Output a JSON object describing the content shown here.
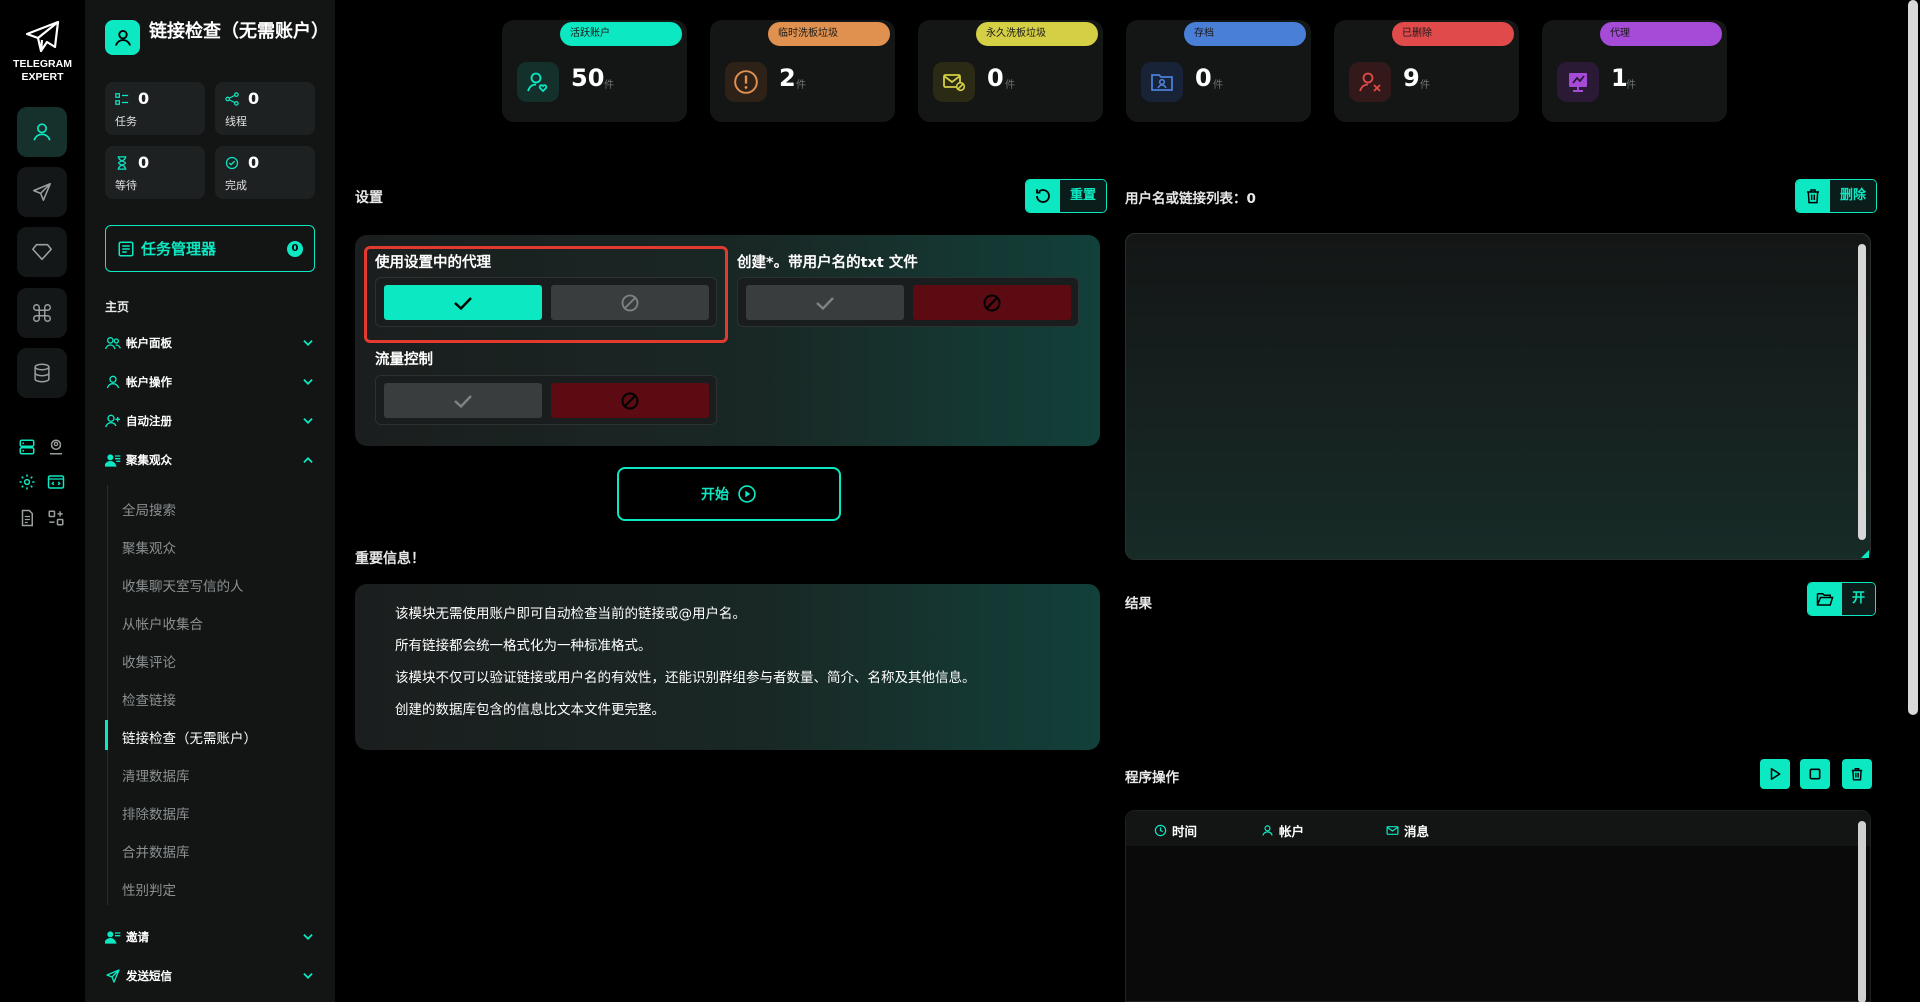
{
  "app": {
    "logo_line1": "TELEGRAM",
    "logo_line2": "EXPERT",
    "accent": "#0ce8c2"
  },
  "sidebar": {
    "page_title": "链接检查（无需账户）",
    "stats": [
      {
        "label": "任务",
        "value": "0",
        "icon": "tasks-icon"
      },
      {
        "label": "线程",
        "value": "0",
        "icon": "threads-icon"
      },
      {
        "label": "等待",
        "value": "0",
        "icon": "hourglass-icon"
      },
      {
        "label": "完成",
        "value": "0",
        "icon": "check-circle-icon"
      }
    ],
    "task_manager": {
      "label": "任务管理器",
      "count": "0"
    },
    "home": "主页",
    "groups": [
      {
        "label": "帐户面板",
        "icon": "users-icon",
        "expanded": false
      },
      {
        "label": "帐户操作",
        "icon": "user-icon",
        "expanded": false
      },
      {
        "label": "自动注册",
        "icon": "user-plus-icon",
        "expanded": false
      },
      {
        "label": "聚集观众",
        "icon": "audience-icon",
        "expanded": true
      }
    ],
    "sub_items": [
      "全局搜索",
      "聚集观众",
      "收集聊天室写信的人",
      "从帐户收集合",
      "收集评论",
      "检查链接",
      "链接检查（无需账户）",
      "清理数据库",
      "排除数据库",
      "合并数据库",
      "性别判定"
    ],
    "active_sub_index": 6,
    "groups_bottom": [
      {
        "label": "邀请",
        "icon": "invite-icon",
        "expanded": false
      },
      {
        "label": "发送短信",
        "icon": "send-icon",
        "expanded": false
      }
    ]
  },
  "top_cards": [
    {
      "tag": "活跃账户",
      "value": "50",
      "unit": "件",
      "color": "#0ce8c2",
      "icon": "user-heart-icon"
    },
    {
      "tag": "临时洗板垃圾",
      "value": "2",
      "unit": "件",
      "color": "#e0904f",
      "icon": "alert-icon"
    },
    {
      "tag": "永久洗板垃圾",
      "value": "0",
      "unit": "件",
      "color": "#d4cf44",
      "icon": "mail-block-icon"
    },
    {
      "tag": "存档",
      "value": "0",
      "unit": "件",
      "color": "#4a7fd8",
      "icon": "archive-icon"
    },
    {
      "tag": "已删除",
      "value": "9",
      "unit": "件",
      "color": "#e04a4a",
      "icon": "user-x-icon"
    },
    {
      "tag": "代理",
      "value": "1",
      "unit": "件",
      "color": "#a64ad8",
      "icon": "proxy-icon"
    }
  ],
  "settings": {
    "title": "设置",
    "reset_label": "重置",
    "options": [
      {
        "label": "使用设置中的代理",
        "enabled": true
      },
      {
        "label": "创建*。带用户名的txt 文件",
        "enabled": false
      },
      {
        "label": "流量控制",
        "enabled": false
      }
    ],
    "start_label": "开始"
  },
  "info": {
    "title": "重要信息！",
    "lines": [
      "该模块无需使用账户即可自动检查当前的链接或@用户名。",
      "所有链接都会统一格式化为一种标准格式。",
      "该模块不仅可以验证链接或用户名的有效性，还能识别群组参与者数量、简介、名称及其他信息。",
      "创建的数据库包含的信息比文本文件更完整。"
    ]
  },
  "list": {
    "title": "用户名或链接列表：0",
    "delete_label": "删除",
    "value": ""
  },
  "result": {
    "title": "结果",
    "open_label": "开"
  },
  "program": {
    "title": "程序操作",
    "columns": [
      "时间",
      "帐户",
      "消息"
    ]
  }
}
